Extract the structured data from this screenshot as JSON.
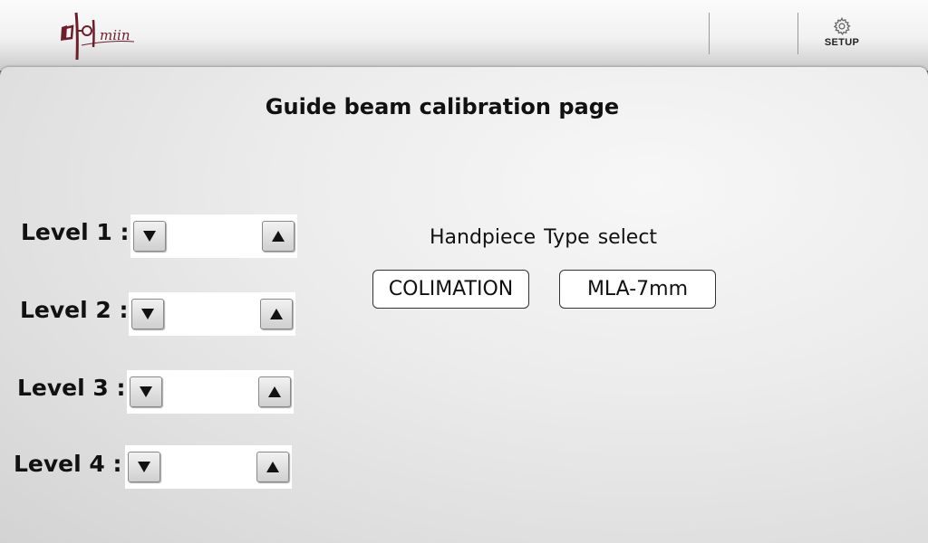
{
  "header": {
    "logo_text_korean": "미인",
    "logo_text_latin": "miin",
    "setup_label": "SETUP",
    "setup_icon": "gear-icon"
  },
  "page": {
    "title": "Guide beam calibration page"
  },
  "levels": [
    {
      "label": "Level 1 :",
      "value": ""
    },
    {
      "label": "Level 2 :",
      "value": ""
    },
    {
      "label": "Level 3 :",
      "value": ""
    },
    {
      "label": "Level 4 :",
      "value": ""
    }
  ],
  "handpiece": {
    "title": "Handpiece  Type select",
    "options": [
      "COLIMATION",
      "MLA-7mm"
    ]
  },
  "colors": {
    "logo": "#6b1f2a",
    "title_text": "#111111",
    "button_border": "#333333"
  }
}
